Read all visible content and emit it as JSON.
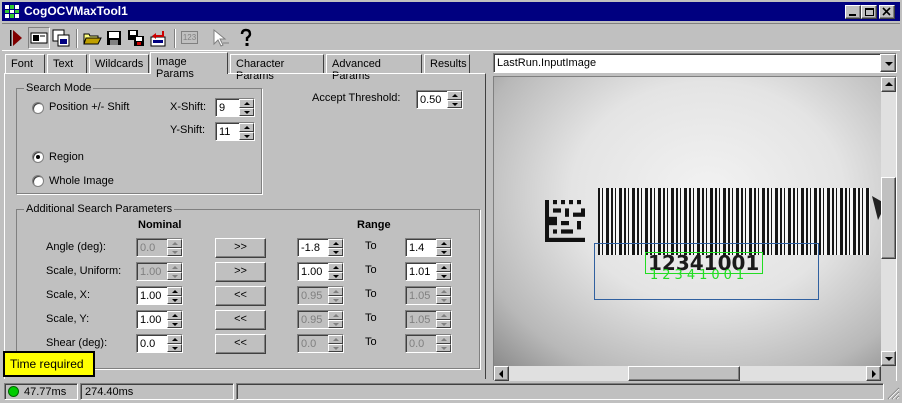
{
  "window": {
    "title": "CogOCVMaxTool1"
  },
  "toolbar": {
    "icons": [
      "run-icon",
      "display-icon",
      "windows-icon",
      "open-folder-icon",
      "save-icon",
      "save-settings-icon",
      "reset-icon",
      "ocv-123-icon",
      "pointer-icon",
      "help-icon"
    ],
    "ocv_label": "123"
  },
  "tabs": [
    "Font",
    "Text",
    "Wildcards",
    "Image Params",
    "Character Params",
    "Advanced Params",
    "Results"
  ],
  "active_tab": "Image Params",
  "search_mode": {
    "legend": "Search Mode",
    "options": [
      "Position +/- Shift",
      "Region",
      "Whole Image"
    ],
    "selected": "Region",
    "x_shift_label": "X-Shift:",
    "x_shift": "9",
    "y_shift_label": "Y-Shift:",
    "y_shift": "11"
  },
  "accept_threshold": {
    "label": "Accept Threshold:",
    "value": "0.50"
  },
  "additional": {
    "legend": "Additional Search Parameters",
    "nominal_header": "Nominal",
    "range_header": "Range",
    "to_label": "To",
    "rows": [
      {
        "label": "Angle (deg):",
        "nominal": "0.0",
        "nominal_enabled": false,
        "button": ">>",
        "low": "-1.8",
        "high": "1.4",
        "range_enabled": true
      },
      {
        "label": "Scale, Uniform:",
        "nominal": "1.00",
        "nominal_enabled": false,
        "button": ">>",
        "low": "1.00",
        "high": "1.01",
        "range_enabled": true
      },
      {
        "label": "Scale, X:",
        "nominal": "1.00",
        "nominal_enabled": true,
        "button": "<<",
        "low": "0.95",
        "high": "1.05",
        "range_enabled": false
      },
      {
        "label": "Scale, Y:",
        "nominal": "1.00",
        "nominal_enabled": true,
        "button": "<<",
        "low": "0.95",
        "high": "1.05",
        "range_enabled": false
      },
      {
        "label": "Shear (deg):",
        "nominal": "0.0",
        "nominal_enabled": true,
        "button": "<<",
        "low": "0.0",
        "high": "0.0",
        "range_enabled": false
      }
    ]
  },
  "tooltip": "Time required",
  "image_selector": {
    "value": "LastRun.InputImage"
  },
  "image": {
    "ocr_text": "12341001",
    "result_text": "12341001"
  },
  "status": {
    "time1": "47.77ms",
    "time2": "274.40ms"
  },
  "colors": {
    "title_bar": "#000080",
    "tooltip_bg": "#ffff00",
    "status_ok": "#00cc00",
    "overlay_green": "#22dd22",
    "overlay_box": "#3060a0"
  }
}
